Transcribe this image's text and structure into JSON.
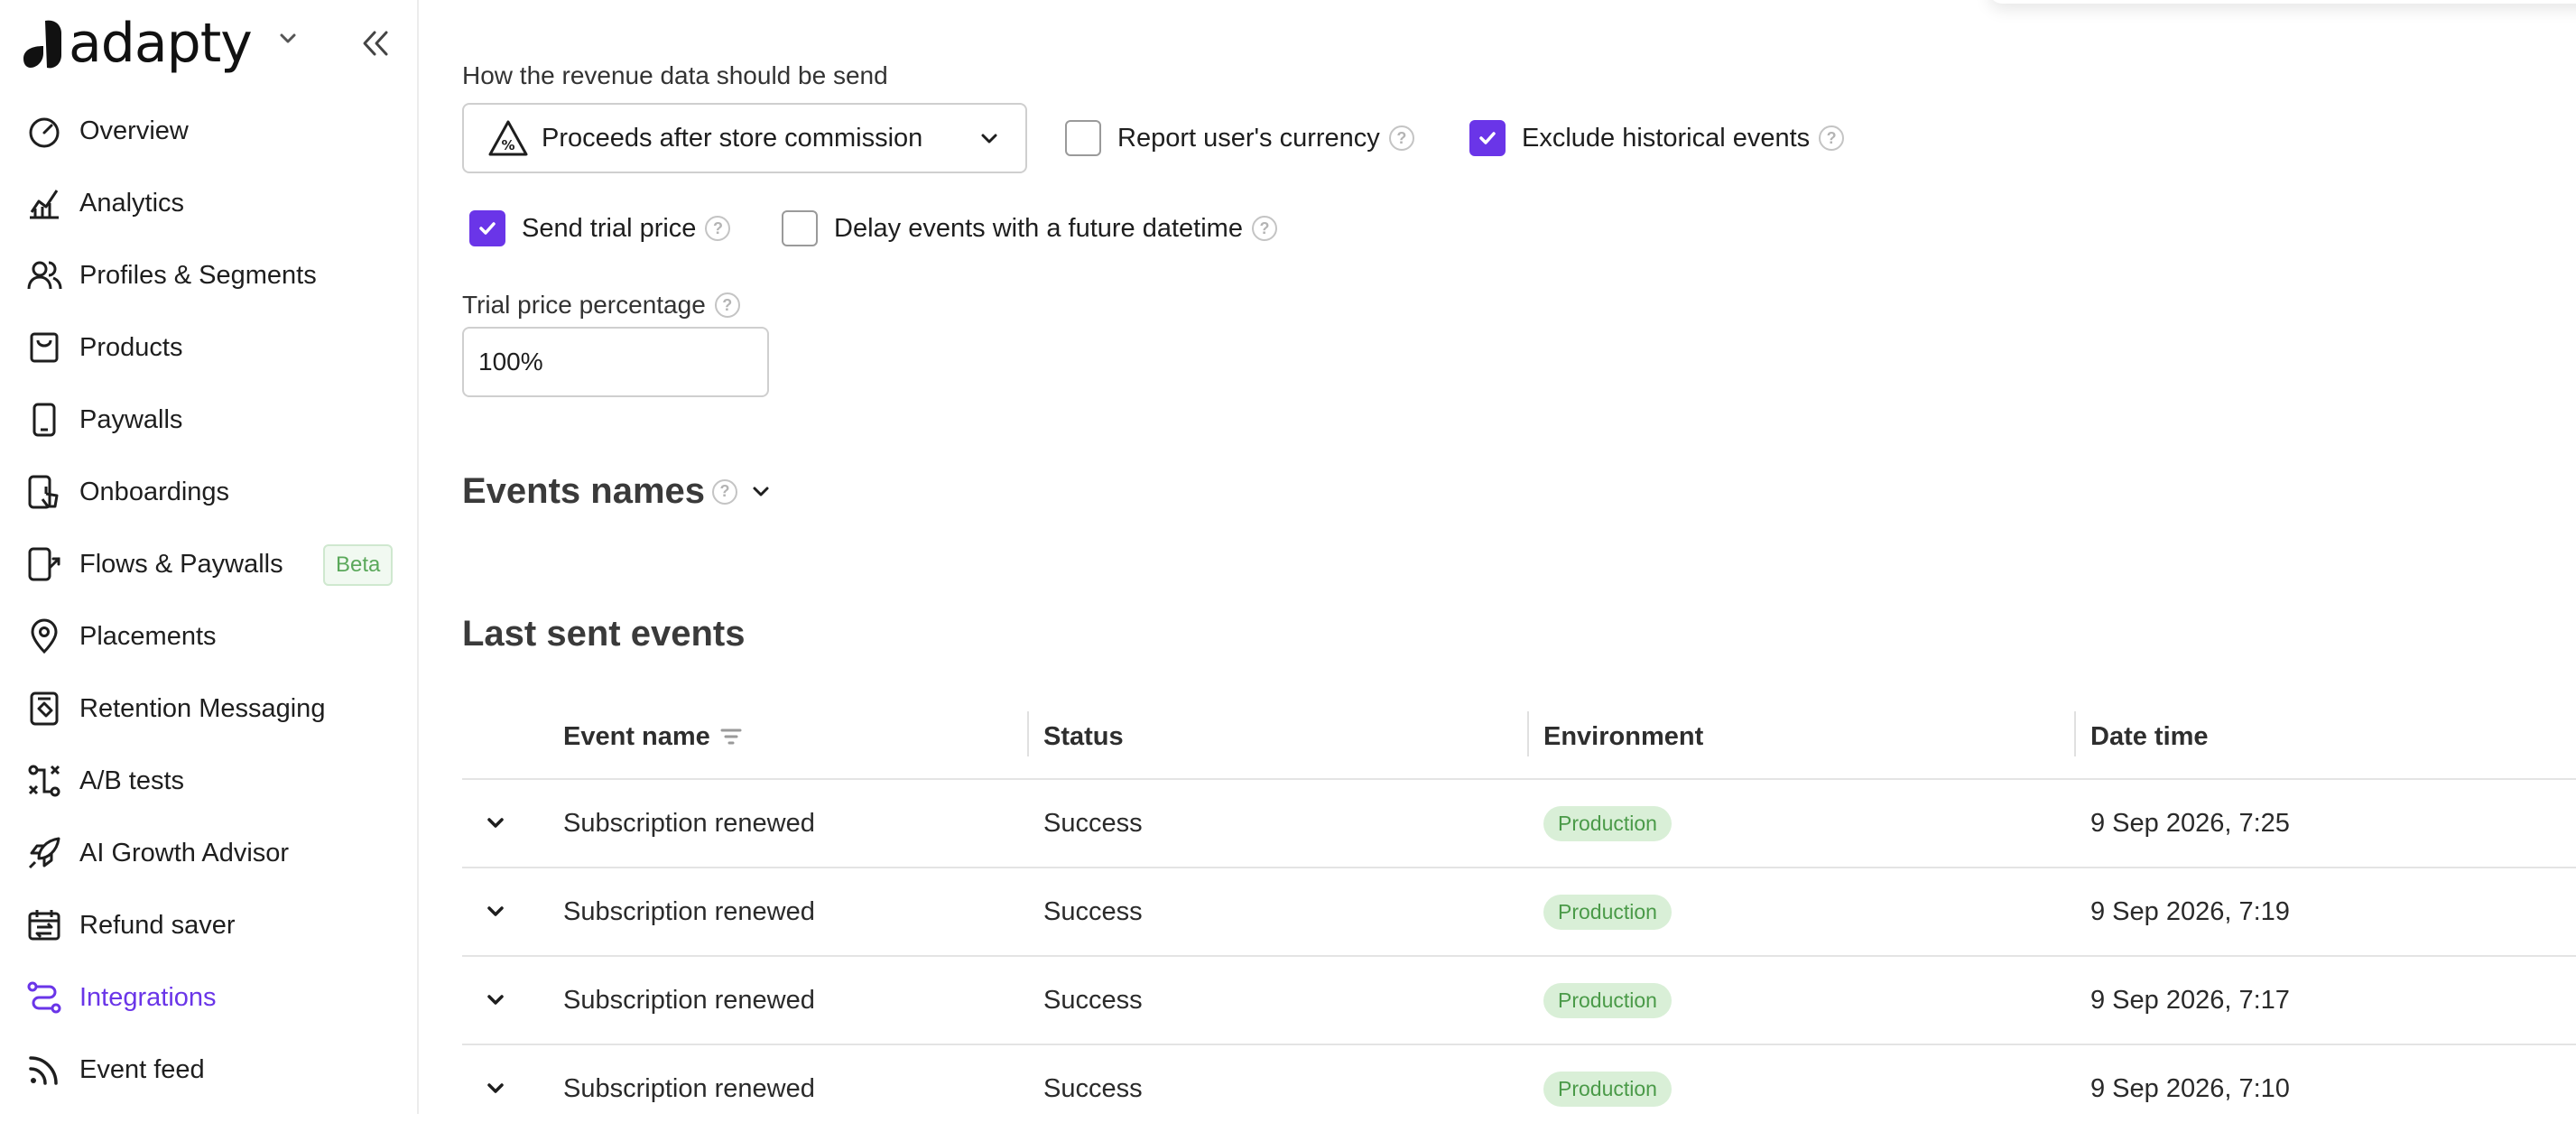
{
  "app": {
    "logo_text": "adapty"
  },
  "sidebar": {
    "items": [
      {
        "label": "Overview",
        "icon": "gauge-icon"
      },
      {
        "label": "Analytics",
        "icon": "chart-icon"
      },
      {
        "label": "Profiles & Segments",
        "icon": "users-icon"
      },
      {
        "label": "Products",
        "icon": "bag-icon"
      },
      {
        "label": "Paywalls",
        "icon": "phone-icon"
      },
      {
        "label": "Onboardings",
        "icon": "phone-tap-icon"
      },
      {
        "label": "Flows & Paywalls",
        "icon": "phone-flow-icon"
      },
      {
        "label": "Placements",
        "icon": "pin-icon"
      },
      {
        "label": "Retention Messaging",
        "icon": "tag-phone-icon"
      },
      {
        "label": "A/B tests",
        "icon": "split-icon"
      },
      {
        "label": "AI Growth Advisor",
        "icon": "rocket-icon"
      },
      {
        "label": "Refund saver",
        "icon": "calendar-refresh-icon"
      },
      {
        "label": "Integrations",
        "icon": "integrations-icon",
        "active": true
      },
      {
        "label": "Event feed",
        "icon": "rss-icon"
      }
    ],
    "beta_badge": "Beta",
    "active_color": "#6a35e8"
  },
  "settings": {
    "revenue_label": "How the revenue data should be send",
    "revenue_select_value": "Proceeds after store commission",
    "report_currency_label": "Report user's currency",
    "report_currency_checked": false,
    "exclude_historical_label": "Exclude historical events",
    "exclude_historical_checked": true,
    "send_trial_label": "Send trial price",
    "send_trial_checked": true,
    "delay_events_label": "Delay events with a future datetime",
    "delay_events_checked": false,
    "trial_pct_label": "Trial price percentage",
    "trial_pct_value": "100%"
  },
  "events_names": {
    "title": "Events names"
  },
  "last_sent": {
    "title": "Last sent events",
    "columns": [
      "Event name",
      "Status",
      "Environment",
      "Date time"
    ],
    "rows": [
      {
        "event": "Subscription renewed",
        "status": "Success",
        "env": "Production",
        "datetime": "9 Sep 2026, 7:25"
      },
      {
        "event": "Subscription renewed",
        "status": "Success",
        "env": "Production",
        "datetime": "9 Sep 2026, 7:19"
      },
      {
        "event": "Subscription renewed",
        "status": "Success",
        "env": "Production",
        "datetime": "9 Sep 2026, 7:17"
      },
      {
        "event": "Subscription renewed",
        "status": "Success",
        "env": "Production",
        "datetime": "9 Sep 2026, 7:10"
      }
    ]
  }
}
